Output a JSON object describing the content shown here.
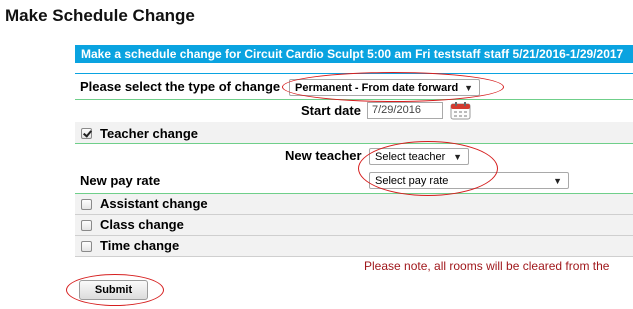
{
  "page": {
    "title": "Make Schedule Change",
    "banner": "Make a schedule change for Circuit Cardio Sculpt 5:00 am Fri teststaff staff 5/21/2016-1/29/2017"
  },
  "form": {
    "change_type_label": "Please select the type of change",
    "change_type_value": "Permanent - From date forward",
    "start_date_label": "Start date",
    "start_date_value": "7/29/2016",
    "teacher_change_label": "Teacher change",
    "teacher_change_checked": true,
    "new_teacher_label": "New teacher",
    "new_teacher_value": "Select teacher",
    "new_pay_rate_label": "New pay rate",
    "new_pay_rate_value": "Select pay rate",
    "assistant_change_label": "Assistant change",
    "class_change_label": "Class change",
    "time_change_label": "Time change",
    "note": "Please note, all rooms will be cleared from the",
    "submit_label": "Submit"
  },
  "icons": {
    "calendar": "calendar-icon",
    "dropdown": "chevron-down-icon",
    "check": "checkmark-icon"
  },
  "colors": {
    "banner": "#0aa3e0",
    "divider_green": "#6fcf8a",
    "annotation_red": "#d61f1f",
    "note_red": "#a0181c"
  }
}
